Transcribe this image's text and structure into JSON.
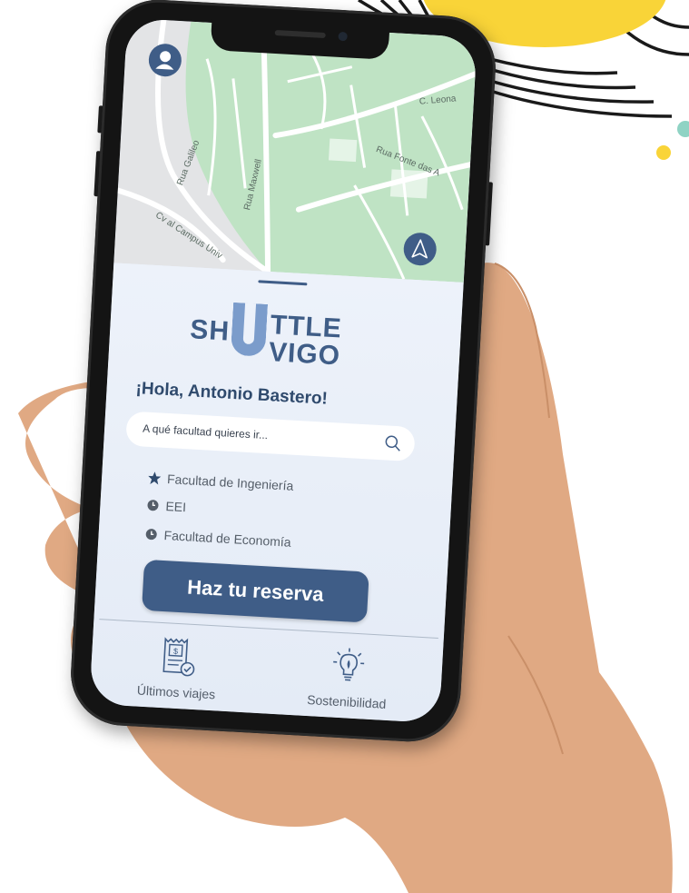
{
  "map": {
    "street_labels": [
      "C. Leona",
      "Rua Fonte das A",
      "Rua Galileo",
      "Rua Maxwell",
      "Cv al Campus Univ"
    ]
  },
  "brand": {
    "line1_left": "SH",
    "line1_right": "TTLE",
    "line2": "VIGO"
  },
  "greeting": "¡Hola, Antonio Bastero!",
  "search": {
    "placeholder": "A qué facultad quieres ir..."
  },
  "recent": [
    {
      "icon": "star-icon",
      "label": "Facultad de Ingeniería"
    },
    {
      "icon": "clock-icon",
      "label": "EEI"
    },
    {
      "icon": "clock-icon",
      "label": "Facultad de Economía"
    }
  ],
  "cta_label": "Haz tu reserva",
  "tabs": [
    {
      "icon": "receipt-icon",
      "label": "Últimos viajes"
    },
    {
      "icon": "lightbulb-icon",
      "label": "Sostenibilidad"
    }
  ],
  "colors": {
    "primary": "#3f5d87",
    "accent": "#7b9ccb",
    "map_green": "#bfe3c4",
    "sun_yellow": "#f9d438"
  }
}
